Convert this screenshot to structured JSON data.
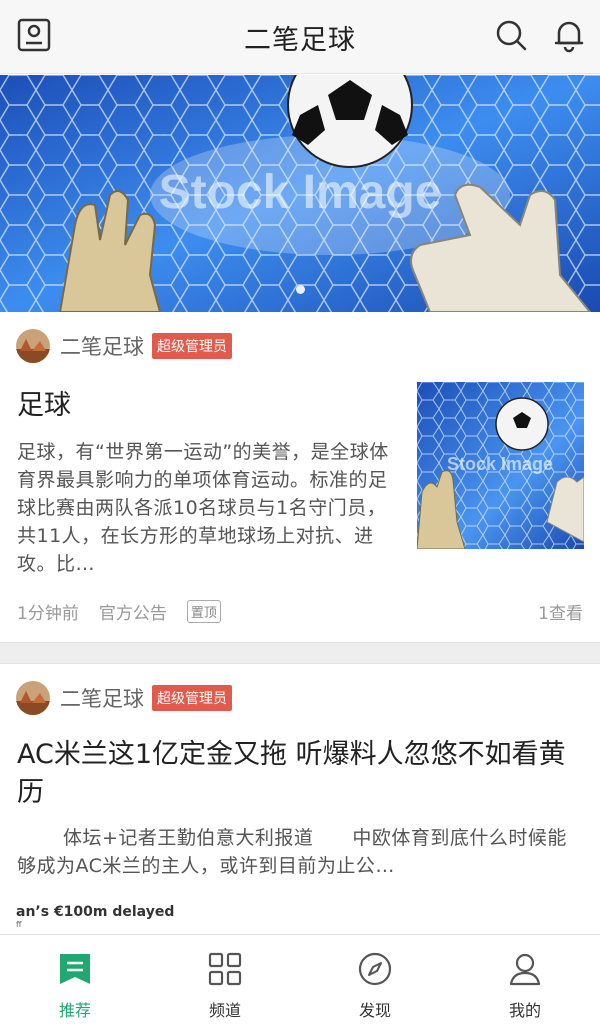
{
  "header": {
    "title": "二笔足球",
    "left_icon": "profile-card-icon",
    "right_icons": [
      "search-icon",
      "bell-icon"
    ]
  },
  "banner": {
    "watermark": "Stock Image",
    "active_dot": 1,
    "dot_count": 1
  },
  "articles": [
    {
      "author": "二笔足球",
      "role": "超级管理员",
      "title": "足球",
      "body": "足球，有“世界第一运动”的美誉，是全球体育界最具影响力的单项体育运动。标准的足球比赛由两队各派10名球员与1名守门员，共11人，在长方形的草地球场上对抗、进攻。比…",
      "thumb_watermark": "Stock Image",
      "time": "1分钟前",
      "category": "官方公告",
      "tag": "置顶",
      "views": "1查看"
    },
    {
      "author": "二笔足球",
      "role": "超级管理员",
      "title": "AC米兰这1亿定金又拖 听爆料人忽悠不如看黄历",
      "body": "体坛+记者王勤伯意大利报道　　中欧体育到底什么时候能够成为AC米兰的主人，或许到目前为止公…",
      "peek_text": "an’s €100m delayed",
      "peek_sub": "ff"
    }
  ],
  "bottom_nav": [
    {
      "label": "推荐",
      "icon": "recommend-icon",
      "active": true
    },
    {
      "label": "频道",
      "icon": "grid-icon",
      "active": false
    },
    {
      "label": "发现",
      "icon": "compass-icon",
      "active": false
    },
    {
      "label": "我的",
      "icon": "person-icon",
      "active": false
    }
  ],
  "colors": {
    "accent": "#21a871",
    "badge": "#e05b4c",
    "header_bg": "#f7f7f7"
  }
}
